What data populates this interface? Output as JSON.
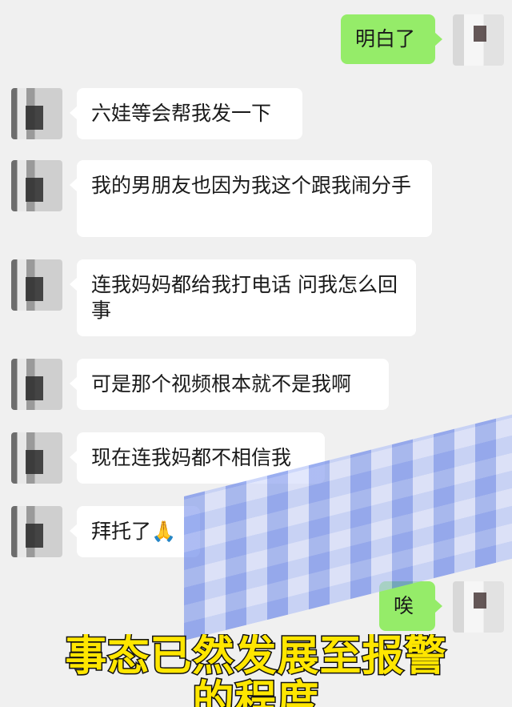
{
  "chat": {
    "messages": [
      {
        "sender": "me",
        "text": "明白了"
      },
      {
        "sender": "other",
        "text": "六娃等会帮我发一下"
      },
      {
        "sender": "other",
        "text": "我的男朋友也因为我这个跟我闹分手"
      },
      {
        "sender": "other",
        "text": "连我妈妈都给我打电话 问我怎么回事"
      },
      {
        "sender": "other",
        "text": "可是那个视频根本就不是我啊"
      },
      {
        "sender": "other",
        "text": "现在连我妈都不相信我"
      },
      {
        "sender": "other",
        "text": "拜托了🙏"
      },
      {
        "sender": "me",
        "text": "唉"
      }
    ]
  },
  "caption": {
    "line1": "事态已然发展至报警",
    "line2": "的程度"
  },
  "colors": {
    "background": "#f0f0f0",
    "incoming_bubble": "#ffffff",
    "outgoing_bubble": "#95ec69",
    "caption_text": "#ffe600"
  }
}
